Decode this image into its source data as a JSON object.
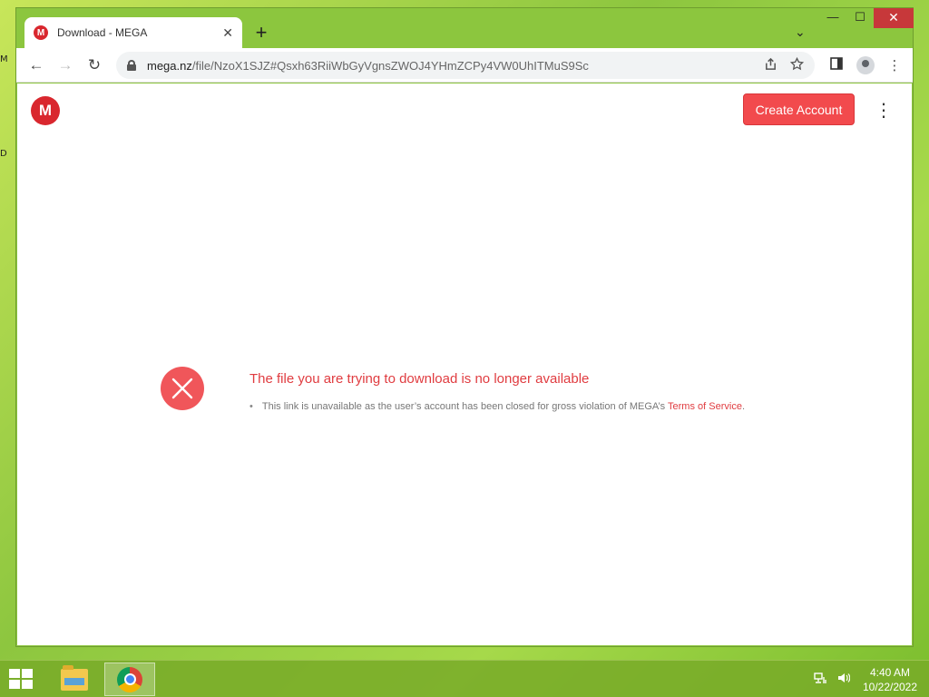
{
  "desktop": {
    "icon_letter_1": "M",
    "icon_letter_2": "D"
  },
  "browser": {
    "tab": {
      "title": "Download - MEGA",
      "favicon_letter": "M",
      "close_glyph": "✕"
    },
    "new_tab_glyph": "+",
    "tab_search_glyph": "⌄",
    "window_controls": {
      "minimize": "—",
      "maximize": "☐",
      "close": "✕"
    },
    "nav": {
      "back": "←",
      "forward": "→",
      "reload": "↻"
    },
    "address": {
      "host": "mega.nz",
      "path": "/file/NzoX1SJZ#Qsxh63RiiWbGyVgnsZWOJ4YHmZCPy4VW0UhITMuS9Sc"
    },
    "icons": {
      "share": "share-icon",
      "bookmark": "star-icon",
      "sidepanel": "sidepanel-icon",
      "profile": "profile-icon",
      "menu": "menu-icon"
    }
  },
  "page": {
    "logo_letter": "M",
    "create_account_label": "Create Account",
    "more_menu_glyph": "⋮",
    "error": {
      "title": "The file you are trying to download is no longer available",
      "detail_prefix": "This link is unavailable as the user’s account has been closed for gross violation of MEGA’s ",
      "detail_link": "Terms of Service",
      "detail_suffix": ".",
      "bullet": "•"
    }
  },
  "taskbar": {
    "clock_time": "4:40 AM",
    "clock_date": "10/22/2022"
  },
  "colors": {
    "brand_red": "#d9272e",
    "button_red": "#f24a4d",
    "error_red": "#e03c40"
  }
}
